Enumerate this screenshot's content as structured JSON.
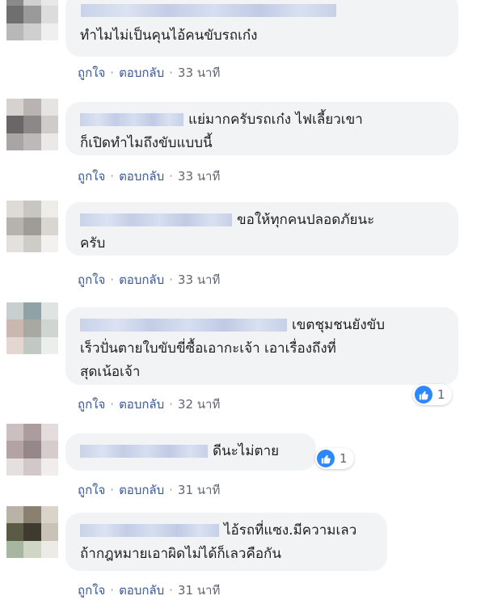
{
  "comments": [
    {
      "text_lines": [
        "ทำไมไม่เป็นคุนไอ้คนขับรถเก๋ง"
      ],
      "like_label": "ถูกใจ",
      "reply_label": "ตอบกลับ",
      "time": "33 นาที",
      "reactions": null,
      "avatar_colors": [
        "#8a8a8a",
        "#d0d0d0",
        "#e8e8e8",
        "#6f6f6f",
        "#9a9a9a",
        "#dcdcdc",
        "#b8b8b8",
        "#cfcfcf",
        "#efefef"
      ]
    },
    {
      "text_lines": [
        "แย่มากครับรถเก๋ง ไฟเลี้ยวเขา",
        "ก็เปิดทำไมถึงขับแบบนี้"
      ],
      "like_label": "ถูกใจ",
      "reply_label": "ตอบกลับ",
      "time": "33 นาที",
      "reactions": null,
      "avatar_colors": [
        "#d6d2d0",
        "#b9b4b2",
        "#e6e4e3",
        "#6a6667",
        "#8c8889",
        "#cfcbca",
        "#a9a5a5",
        "#bdb9b8",
        "#ebe9e8"
      ]
    },
    {
      "text_lines": [
        "ขอให้ทุกคนปลอดภัยนะ",
        "ครับ"
      ],
      "like_label": "ถูกใจ",
      "reply_label": "ตอบกลับ",
      "time": "33 นาที",
      "reactions": null,
      "avatar_colors": [
        "#dedbd6",
        "#c8c6c1",
        "#eeece9",
        "#b6b3ae",
        "#9f9c97",
        "#d9d6d2",
        "#e3e1dd",
        "#cfccc8",
        "#f2f1ef"
      ]
    },
    {
      "text_lines": [
        "เขตชุมชนยังขับ",
        "เร็วปั่นตายใบขับขี่ซื้อเอากะเจ้า เอาเรื่องถึงที่",
        "สุดเน้อเจ้า"
      ],
      "like_label": "ถูกใจ",
      "reply_label": "ตอบกลับ",
      "time": "32 นาที",
      "reactions": "1",
      "avatar_colors": [
        "#c7cfcf",
        "#8fa3a6",
        "#dfe4e3",
        "#c9b7b0",
        "#a9a9a3",
        "#cfd5d0",
        "#e4d6d0",
        "#c2c9c5",
        "#eceeec"
      ]
    },
    {
      "text_lines": [
        "ดีนะไม่ตาย"
      ],
      "like_label": "ถูกใจ",
      "reply_label": "ตอบกลับ",
      "time": "31 นาที",
      "reactions": "1",
      "avatar_colors": [
        "#cbbfc1",
        "#ad9c9f",
        "#e3dbdc",
        "#b3a3a4",
        "#96888a",
        "#d6cccd",
        "#e6dfe0",
        "#d2c8c9",
        "#f1eded"
      ]
    },
    {
      "text_lines": [
        "ไอ้รถที่แซง.มีความเลว",
        "ถ้ากฎหมายเอาผิดไม่ได้ก็เลวคือกัน"
      ],
      "like_label": "ถูกใจ",
      "reply_label": "ตอบกลับ",
      "time": "31 นาที",
      "reactions": null,
      "avatar_colors": [
        "#b9b3a7",
        "#8a8070",
        "#d9d4c8",
        "#5b5a45",
        "#3e3a2e",
        "#c9c3b5",
        "#a7b6a0",
        "#cfd6c6",
        "#ecebe6"
      ]
    }
  ]
}
